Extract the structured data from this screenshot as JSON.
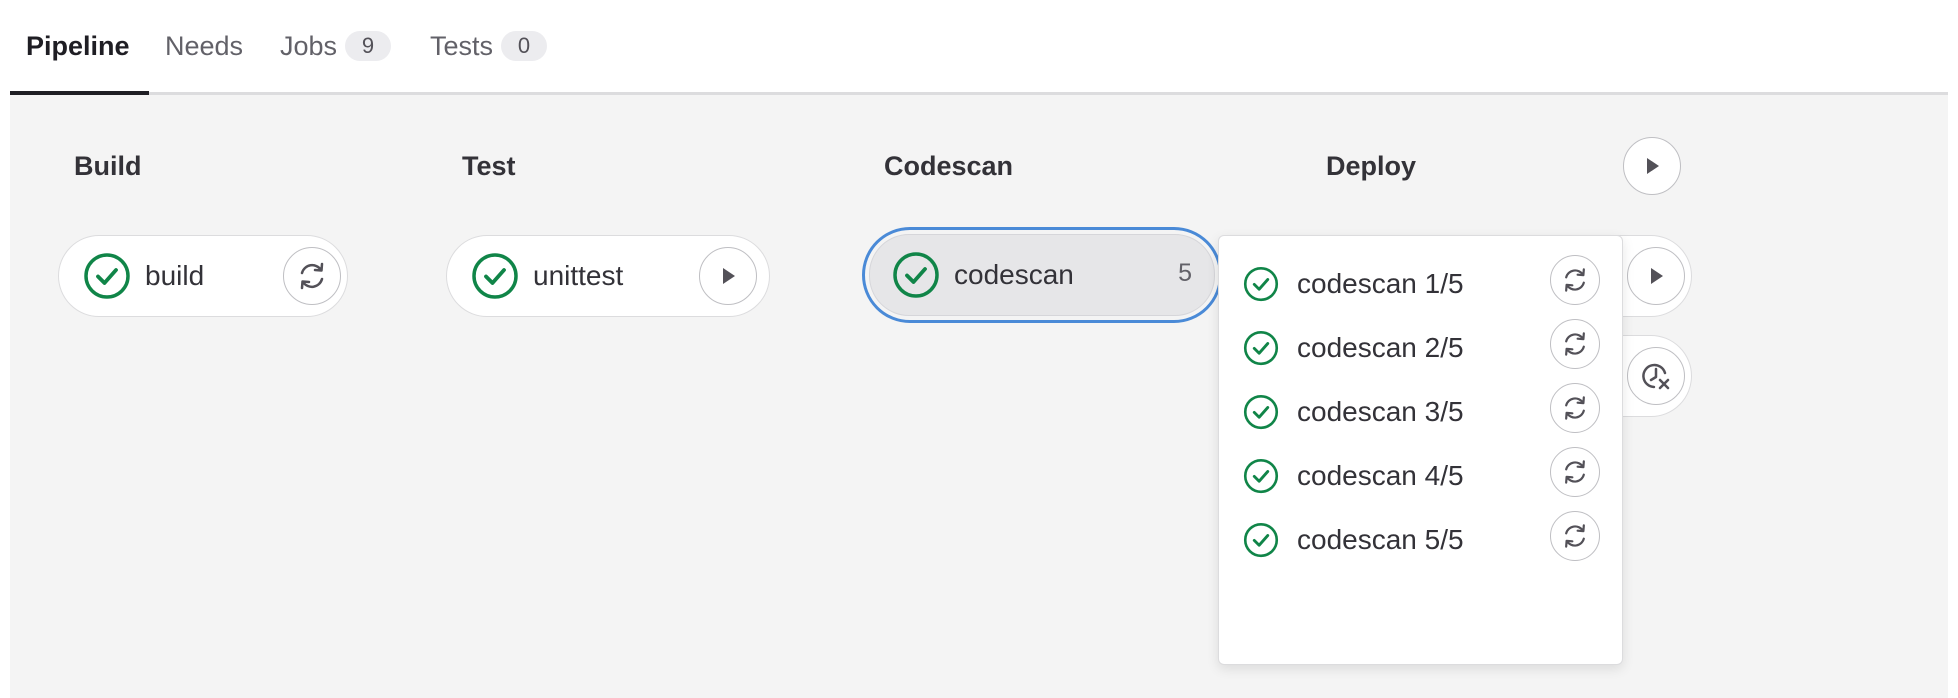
{
  "tabs": [
    {
      "label": "Pipeline",
      "active": true
    },
    {
      "label": "Needs"
    },
    {
      "label": "Jobs",
      "count": "9"
    },
    {
      "label": "Tests",
      "count": "0"
    }
  ],
  "stages": {
    "build": {
      "title": "Build",
      "job": "build",
      "status": "success",
      "action": "retry"
    },
    "test": {
      "title": "Test",
      "job": "unittest",
      "status": "success",
      "action": "play"
    },
    "codescan": {
      "title": "Codescan",
      "job": "codescan",
      "count": "5",
      "status": "success"
    },
    "deploy": {
      "title": "Deploy",
      "stage_action": "play",
      "job_actions": [
        "play",
        "unschedule"
      ]
    }
  },
  "dropdown": {
    "items": [
      {
        "name": "codescan 1/5",
        "status": "success",
        "action": "retry"
      },
      {
        "name": "codescan 2/5",
        "status": "success",
        "action": "retry"
      },
      {
        "name": "codescan 3/5",
        "status": "success",
        "action": "retry"
      },
      {
        "name": "codescan 4/5",
        "status": "success",
        "action": "retry"
      },
      {
        "name": "codescan 5/5",
        "status": "success",
        "action": "retry"
      }
    ]
  },
  "colors": {
    "success": "#108548",
    "focus_ring": "#4a8ad7",
    "background": "#f4f4f4",
    "icon": "#535158"
  }
}
